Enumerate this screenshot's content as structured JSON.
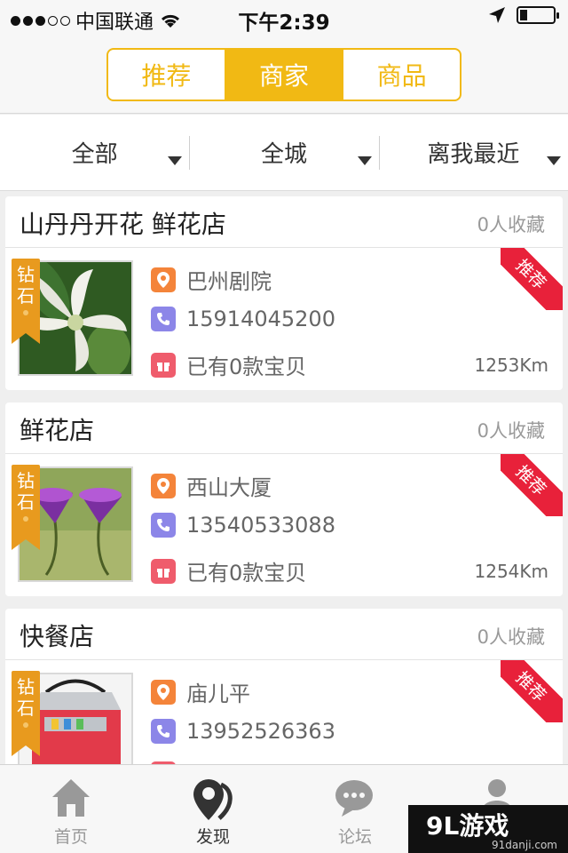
{
  "status_bar": {
    "carrier": "中国联通",
    "time": "下午2:39"
  },
  "segment": {
    "tabs": [
      {
        "label": "推荐"
      },
      {
        "label": "商家"
      },
      {
        "label": "商品"
      }
    ],
    "active_index": 1,
    "accent_color": "#f1b914"
  },
  "filters": [
    {
      "label": "全部"
    },
    {
      "label": "全城"
    },
    {
      "label": "离我最近"
    }
  ],
  "shops": [
    {
      "name": "山丹丹开花 鲜花店",
      "favorites": "0人收藏",
      "badge": "钻石",
      "ribbon": "推荐",
      "address": "巴州剧院",
      "phone": "15914045200",
      "products": "已有0款宝贝",
      "distance": "1253Km",
      "image": "white-flower"
    },
    {
      "name": "鲜花店",
      "favorites": "0人收藏",
      "badge": "钻石",
      "ribbon": "推荐",
      "address": "西山大厦",
      "phone": "13540533088",
      "products": "已有0款宝贝",
      "distance": "1254Km",
      "image": "purple-flower"
    },
    {
      "name": "快餐店",
      "favorites": "0人收藏",
      "badge": "钻石",
      "ribbon": "推荐",
      "address": "庙儿平",
      "phone": "13952526363",
      "products": "",
      "distance": "",
      "image": "red-cooler-bag"
    }
  ],
  "tabbar": {
    "items": [
      {
        "label": "首页",
        "icon": "home-icon"
      },
      {
        "label": "发现",
        "icon": "location-discover-icon"
      },
      {
        "label": "论坛",
        "icon": "chat-bubble-icon"
      },
      {
        "label": "",
        "icon": "user-icon"
      }
    ],
    "active_index": 1
  },
  "watermark": {
    "brand": "9L游戏",
    "url": "91danji.com"
  },
  "colors": {
    "ribbon_red": "#e8213a",
    "badge_orange": "#e89a1e",
    "location_icon": "#f4843a",
    "phone_icon": "#8c86e8",
    "gift_icon": "#ef5c6c"
  }
}
